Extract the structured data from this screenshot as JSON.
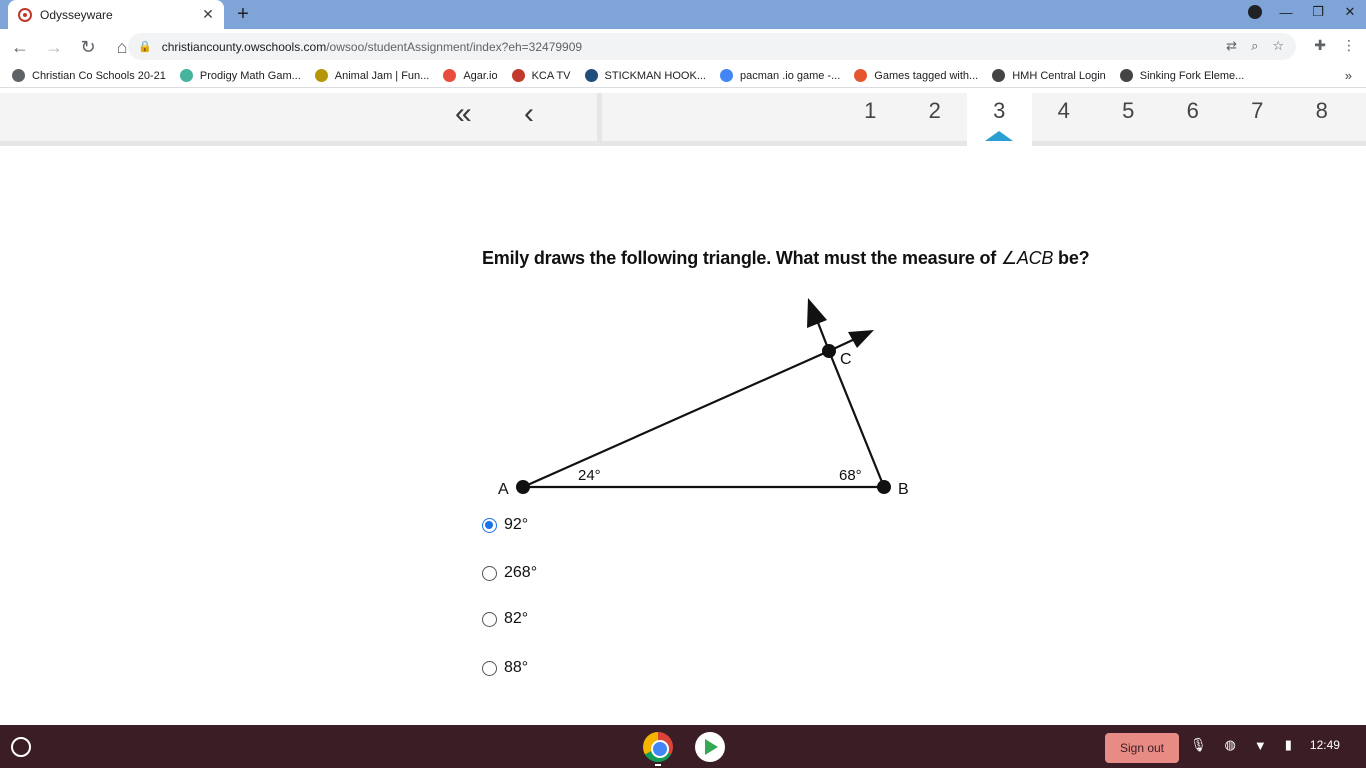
{
  "browser": {
    "tab_title": "Odysseyware",
    "tab_close": "✕",
    "new_tab": "+",
    "url_host": "christiancounty.owschools.com",
    "url_path": "/owsoo/studentAssignment/index?eh=32479909",
    "bookmarks": [
      {
        "label": "Christian Co Schools 20-21",
        "color": "#5f6368"
      },
      {
        "label": "Prodigy Math Gam...",
        "color": "#45b39d"
      },
      {
        "label": "Animal Jam | Fun...",
        "color": "#b7950b"
      },
      {
        "label": "Agar.io",
        "color": "#e74c3c"
      },
      {
        "label": "KCA TV",
        "color": "#c0392b"
      },
      {
        "label": "STICKMAN HOOK...",
        "color": "#1f4e79"
      },
      {
        "label": "pacman .io game -...",
        "color": "#4285f4"
      },
      {
        "label": "Games tagged with...",
        "color": "#e4572e"
      },
      {
        "label": "HMH Central Login",
        "color": "#444444"
      },
      {
        "label": "Sinking Fork Eleme...",
        "color": "#444444"
      }
    ],
    "more_bookmarks": "»"
  },
  "app_nav": {
    "first_label": "«",
    "prev_label": "‹",
    "pages": [
      "1",
      "2",
      "3",
      "4",
      "5",
      "6",
      "7",
      "8"
    ],
    "active_page": "3"
  },
  "question": {
    "text": "Emily draws the following triangle. What must the measure of ",
    "angle_symbol": "∠",
    "angle_name": "ACB",
    "text_end": " be?"
  },
  "figure": {
    "vertex_a": "A",
    "vertex_b": "B",
    "vertex_c": "C",
    "angle_a_label": "24°",
    "angle_b_label": "68°"
  },
  "choices": [
    {
      "label": "92°",
      "selected": true
    },
    {
      "label": "268°",
      "selected": false
    },
    {
      "label": "82°",
      "selected": false
    },
    {
      "label": "88°",
      "selected": false
    }
  ],
  "shelf": {
    "sign_out": "Sign out",
    "time": "12:49"
  }
}
